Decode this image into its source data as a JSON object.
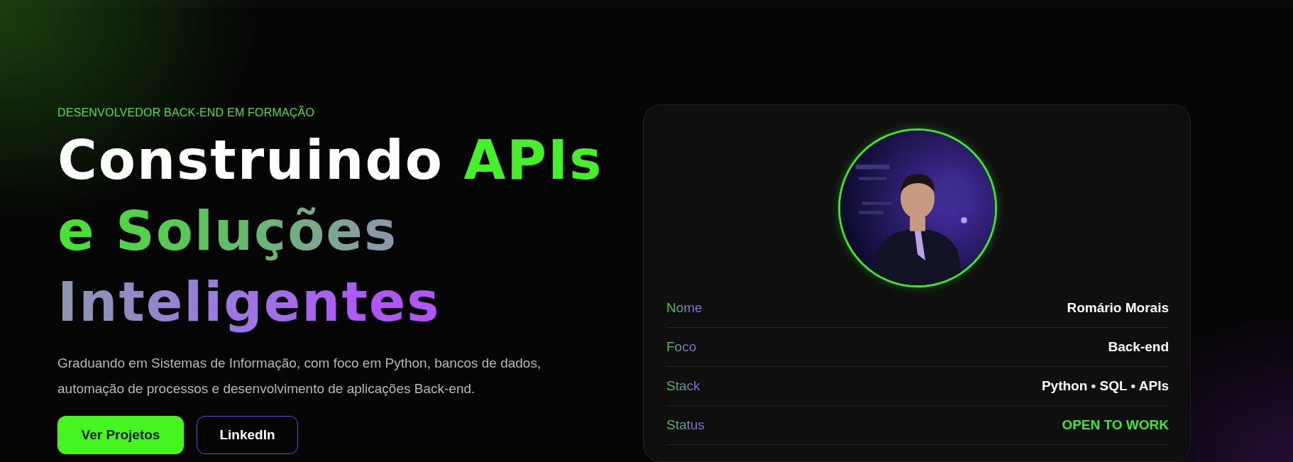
{
  "hero": {
    "eyebrow": "DESENVOLVEDOR BACK-END EM FORMAÇÃO",
    "heading": [
      {
        "text": "Construindo ",
        "kind": "plain"
      },
      {
        "text": "APIs",
        "kind": "accent"
      },
      {
        "text": " e Soluções Inteligentes",
        "kind": "gradient"
      }
    ],
    "description": "Graduando em Sistemas de Informação, com foco em Python, bancos de dados, automação de processos e desenvolvimento de aplicações Back-end.",
    "buttons": [
      {
        "label": "Ver Projetos",
        "kind": "primary"
      },
      {
        "label": "LinkedIn",
        "kind": "outline"
      }
    ]
  },
  "profile_card": {
    "rows": [
      {
        "label": "Nome",
        "value": "Romário Morais",
        "highlight": false
      },
      {
        "label": "Foco",
        "value": "Back-end",
        "highlight": false
      },
      {
        "label": "Stack",
        "value": "Python • SQL • APIs",
        "highlight": false
      },
      {
        "label": "Status",
        "value": "OPEN TO WORK",
        "highlight": true
      }
    ]
  }
}
